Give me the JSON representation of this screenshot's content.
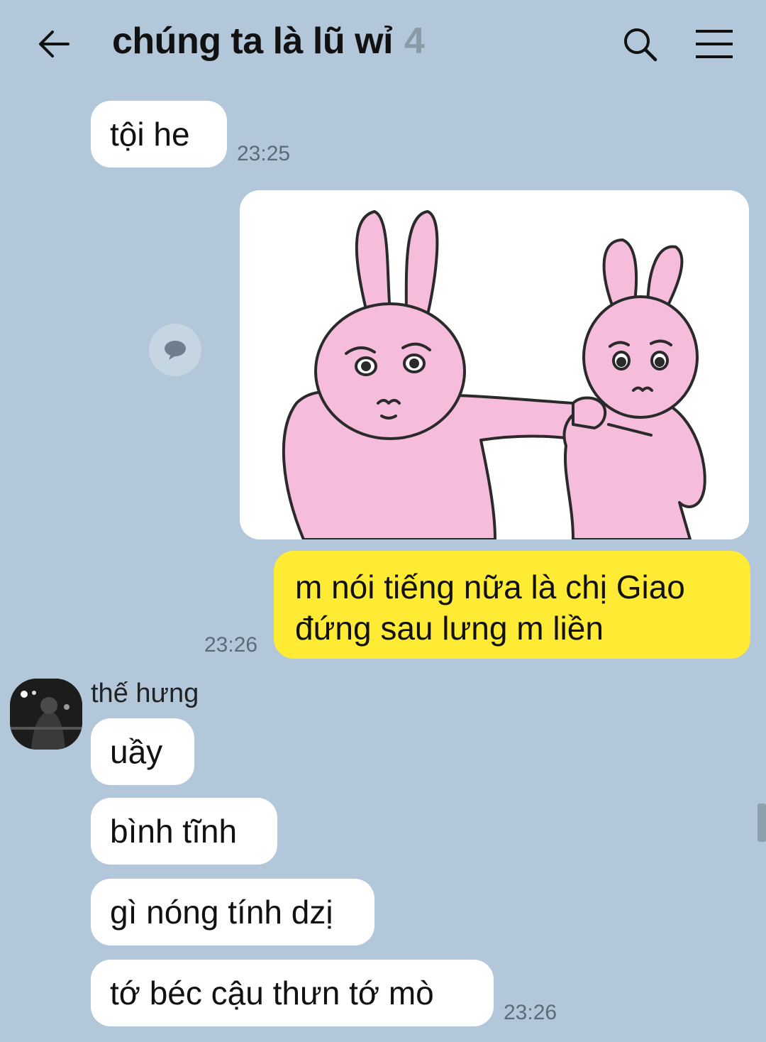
{
  "header": {
    "title": "chúng ta là lũ wỉ",
    "member_count": "4"
  },
  "messages": {
    "m1": {
      "text": "tội he",
      "time": "23:25"
    },
    "m2": {
      "time": "23:26"
    },
    "m3": {
      "text": "m nói tiếng nữa là chị Giao đứng sau lưng m liền"
    },
    "sender": {
      "name": "thế hưng"
    },
    "m4": {
      "text": "uầy"
    },
    "m5": {
      "text": "bình tĩnh"
    },
    "m6": {
      "text": "gì nóng tính dzị"
    },
    "m7": {
      "text": "tớ béc cậu thưn tớ mò",
      "time": "23:26"
    }
  },
  "icons": {
    "back": "arrow-left-icon",
    "search": "search-icon",
    "menu": "hamburger-menu-icon",
    "share": "chat-bubble-share-icon"
  },
  "colors": {
    "background": "#b2c7d9",
    "my_bubble": "#ffeb33",
    "their_bubble": "#ffffff",
    "sticker_pink": "#f6bcdc"
  }
}
